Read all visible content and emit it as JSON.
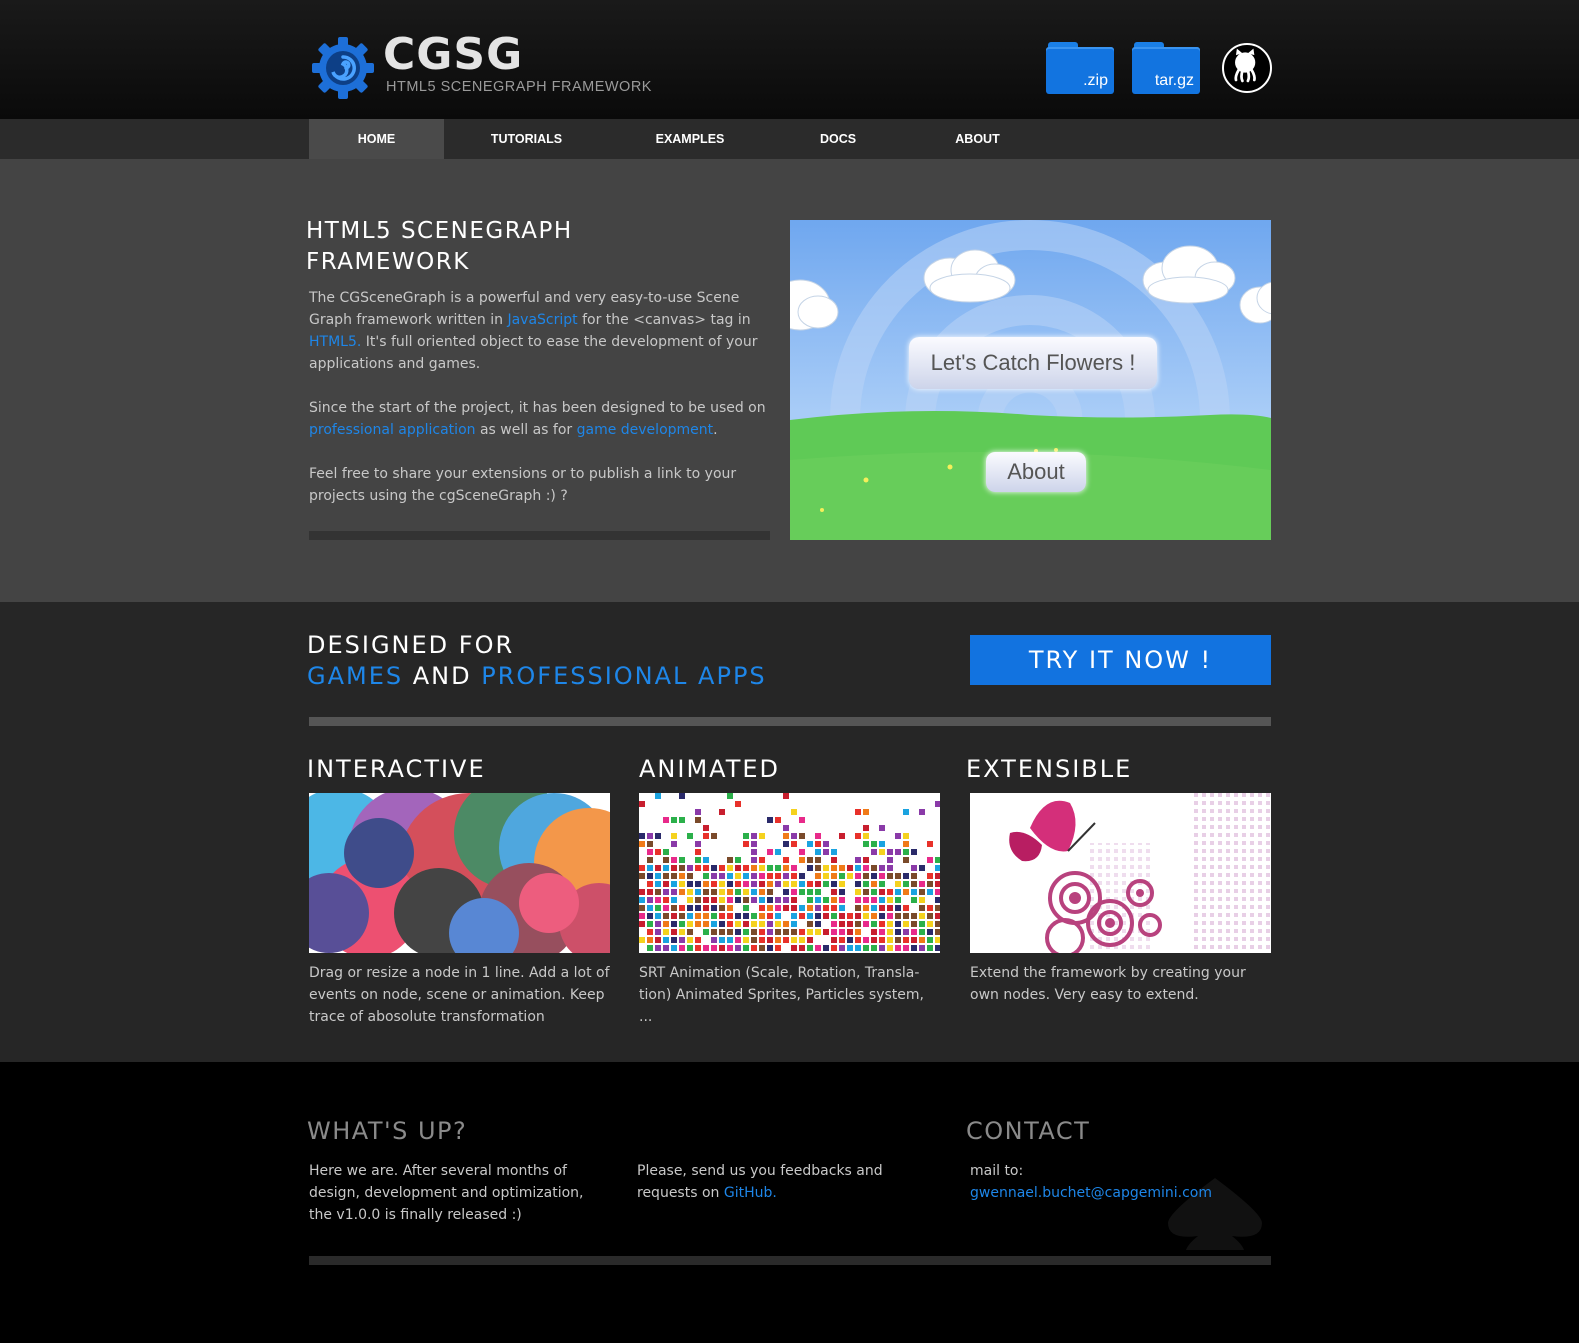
{
  "header": {
    "logo_title": "CGSG",
    "logo_subtitle": "HTML5 SCENEGRAPH FRAMEWORK",
    "downloads": [
      {
        "label": ".zip",
        "icon": "folder-icon"
      },
      {
        "label": "tar.gz",
        "icon": "folder-icon"
      }
    ],
    "github_icon": "github-octocat-icon",
    "accent_color": "#1273e0"
  },
  "nav": {
    "items": [
      {
        "label": "HOME",
        "active": true
      },
      {
        "label": "TUTORIALS",
        "active": false
      },
      {
        "label": "EXAMPLES",
        "active": false
      },
      {
        "label": "DOCS",
        "active": false
      },
      {
        "label": "ABOUT",
        "active": false
      }
    ]
  },
  "hero": {
    "title_line1": "HTML5 SCENEGRAPH",
    "title_line2": "FRAMEWORK",
    "p1_a": "The CGSceneGraph is a powerful and very easy-to-use Scene Graph framework written in ",
    "p1_link1": "JavaScript",
    "p1_b": " for the <canvas> tag in ",
    "p1_link2": "HTML5.",
    "p1_c": " It's full oriented object to ease the development of your applications and games.",
    "p2_a": "Since the start of the project, it has been designed to be used on ",
    "p2_link1": "professional application",
    "p2_b": " as well as for ",
    "p2_link2": "game development",
    "p2_c": ".",
    "p3": "Feel free to share your extensions or to publish a link to your projects using the cgSceneGraph :) ?",
    "demo": {
      "button1": "Let's Catch Flowers !",
      "button2": "About"
    }
  },
  "designed": {
    "line1": "DESIGNED FOR",
    "games": "GAMES",
    "and": " AND ",
    "pro": "PROFESSIONAL APPS",
    "cta": "TRY IT NOW !"
  },
  "features": [
    {
      "title": "INTERACTIVE",
      "text": "Drag or resize a node in 1 line. Add a lot of events on node, scene or animation. Keep trace of abosolute transformation"
    },
    {
      "title": "ANIMATED",
      "text": "SRT Animation (Scale, Rotation, Transla-tion) Animated Sprites, Particles system, ..."
    },
    {
      "title": "EXTENSIBLE",
      "text": "Extend the framework by creating your own nodes. Very easy to extend."
    }
  ],
  "footer": {
    "whatsup_title": "WHAT'S UP?",
    "whatsup_text": "Here we are. After several months of design, development and optimization, the v1.0.0 is finally released :)",
    "feedback_a": "Please, send us you feedbacks and requests on ",
    "feedback_link": "GitHub.",
    "contact_title": "CONTACT",
    "contact_label": "mail to:",
    "contact_email": "gwennael.buchet@capgemini.com",
    "spade_icon": "spade-icon"
  }
}
